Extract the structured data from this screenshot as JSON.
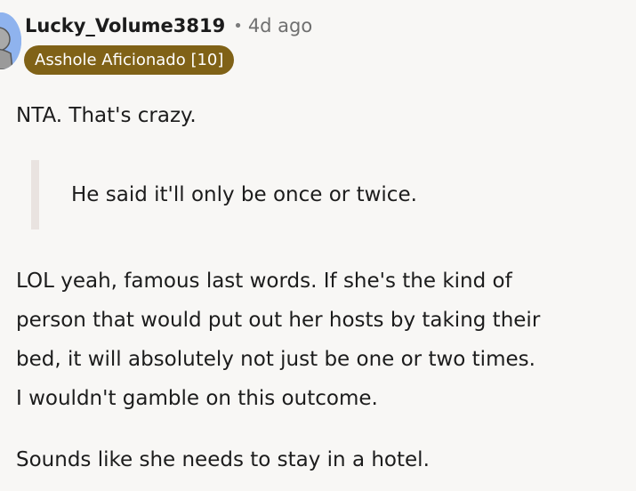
{
  "comment": {
    "username": "Lucky_Volume3819",
    "separator": "•",
    "timestamp": "4d ago",
    "flair": "Asshole Aficionado [10]",
    "flair_color": "#806217",
    "avatar_icon": "user-avatar-icon",
    "paragraphs": {
      "first": "NTA. That's crazy.",
      "quote": "He said it'll only be once or twice.",
      "third_lines": [
        "LOL yeah, famous last words. If she's the kind of",
        "person that would put out her hosts by taking their",
        "bed, it will absolutely not just be one or two times.",
        "I wouldn't gamble on this outcome."
      ],
      "fourth": "Sounds like she needs to stay in a hotel."
    }
  }
}
